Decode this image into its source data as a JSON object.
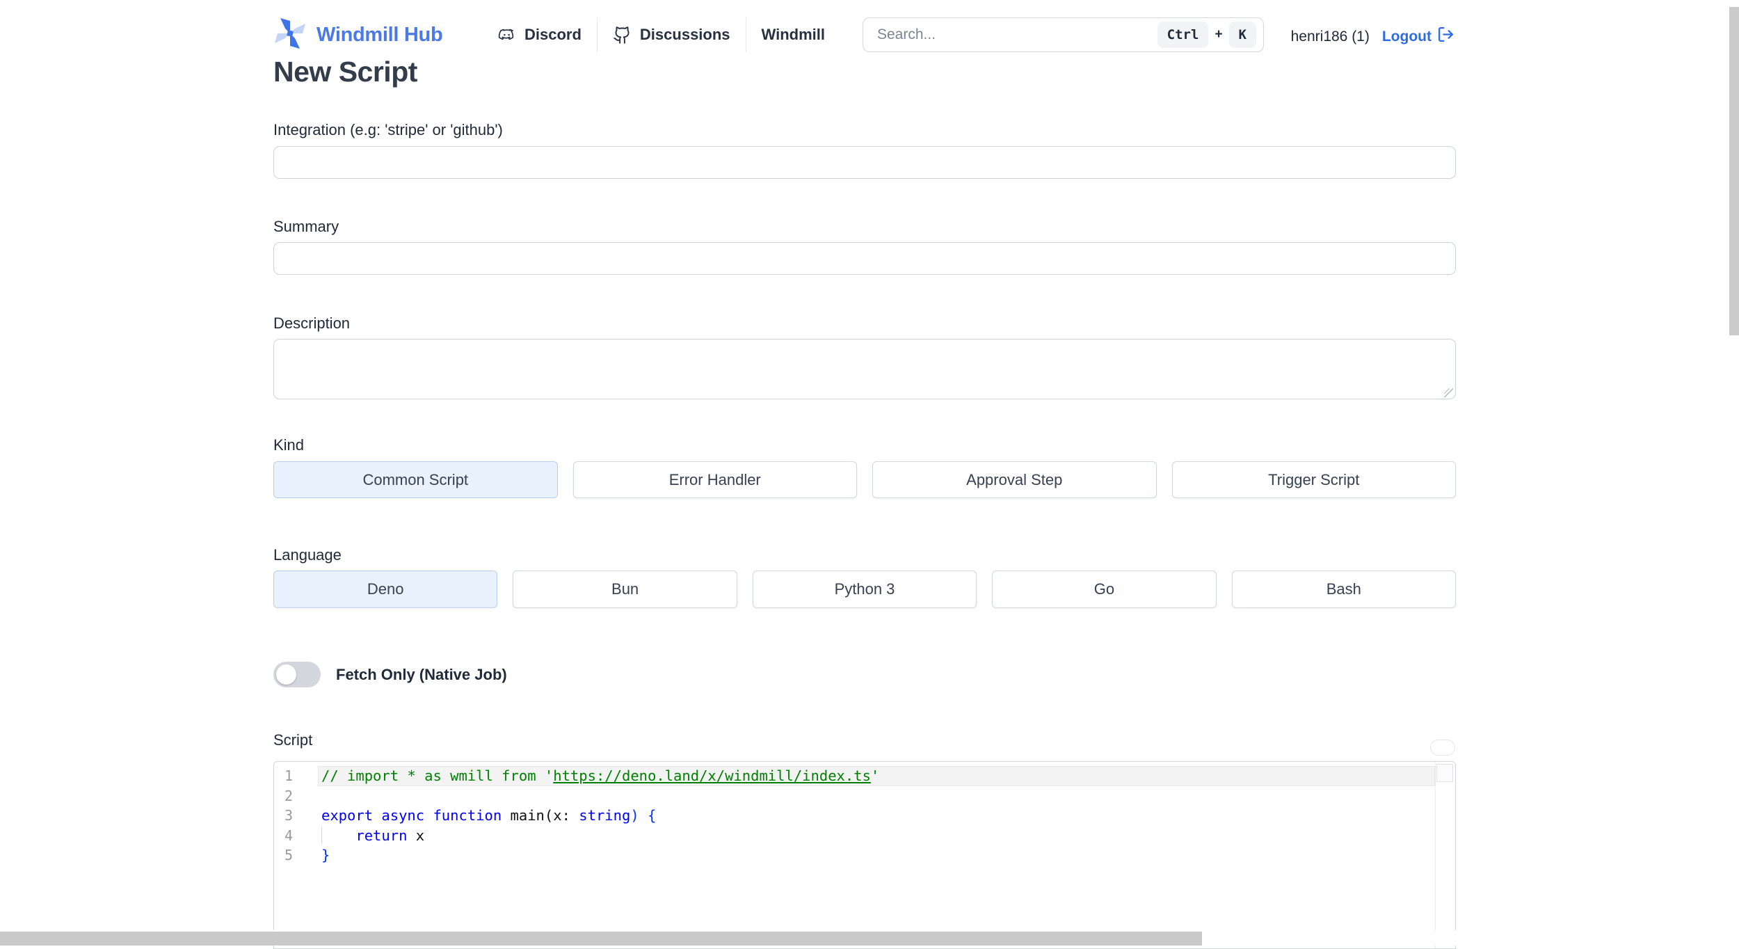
{
  "colors": {
    "brand_blue": "#4a79e8",
    "link_blue": "#2e6be6",
    "selected_option_bg": "#e9f1fc",
    "selected_option_border": "#b7cfec",
    "comment_green": "#008000",
    "keyword_blue": "#0000ff",
    "bracket_blue": "#0431fa",
    "scrollbar_gray": "#c9c9c9"
  },
  "header": {
    "brand": "Windmill Hub",
    "nav": [
      {
        "label": "Discord"
      },
      {
        "label": "Discussions"
      },
      {
        "label": "Windmill"
      }
    ],
    "search": {
      "placeholder": "Search...",
      "kbd_ctrl": "Ctrl",
      "kbd_plus": "+",
      "kbd_k": "K"
    },
    "user": "henri186 (1)",
    "logout": "Logout"
  },
  "page": {
    "title": "New Script"
  },
  "form": {
    "integration": {
      "label": "Integration (e.g: 'stripe' or 'github')",
      "value": ""
    },
    "summary": {
      "label": "Summary",
      "value": ""
    },
    "description": {
      "label": "Description",
      "value": ""
    },
    "kind": {
      "label": "Kind",
      "options": [
        "Common Script",
        "Error Handler",
        "Approval Step",
        "Trigger Script"
      ],
      "selected": "Common Script"
    },
    "language": {
      "label": "Language",
      "options": [
        "Deno",
        "Bun",
        "Python 3",
        "Go",
        "Bash"
      ],
      "selected": "Deno"
    },
    "fetch_only": {
      "label": "Fetch Only (Native Job)",
      "enabled": false
    },
    "script": {
      "label": "Script"
    }
  },
  "editor": {
    "lines": [
      {
        "num": "1",
        "tokens": [
          {
            "text": "// import * as wmill from '"
          },
          {
            "text": "https://deno.land/x/windmill/index.ts"
          },
          {
            "text": "'"
          }
        ]
      },
      {
        "num": "2",
        "tokens": []
      },
      {
        "num": "3",
        "tokens": [
          {
            "text": "export async function "
          },
          {
            "text": "main"
          },
          {
            "text": "(x: "
          },
          {
            "text": "string"
          },
          {
            "text": ") "
          },
          {
            "text": "{"
          }
        ]
      },
      {
        "num": "4",
        "tokens": [
          {
            "text": "    "
          },
          {
            "text": "return"
          },
          {
            "text": " x"
          }
        ]
      },
      {
        "num": "5",
        "tokens": [
          {
            "text": "}"
          }
        ]
      }
    ]
  }
}
